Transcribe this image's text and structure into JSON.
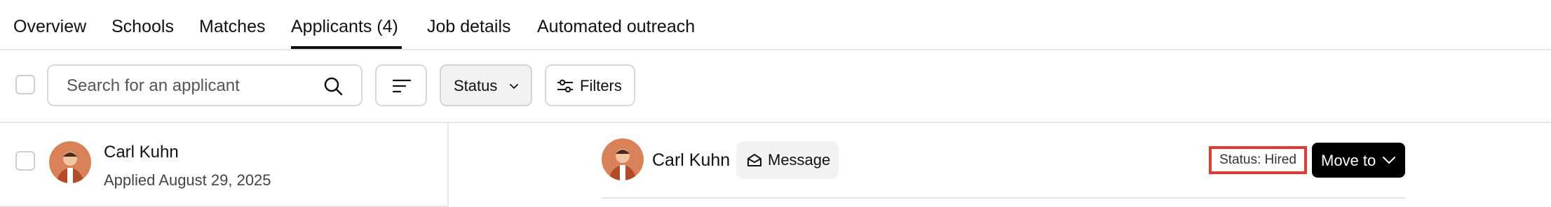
{
  "tabs": [
    {
      "label": "Overview"
    },
    {
      "label": "Schools"
    },
    {
      "label": "Matches"
    },
    {
      "label": "Applicants (4)",
      "active": true
    },
    {
      "label": "Job details"
    },
    {
      "label": "Automated outreach"
    }
  ],
  "toolbar": {
    "search_placeholder": "Search for an applicant",
    "sort_icon": "sort-lines-icon",
    "status_label": "Status",
    "filters_label": "Filters"
  },
  "applicant_list": [
    {
      "name": "Carl Kuhn",
      "applied": "Applied August 29, 2025"
    }
  ],
  "detail": {
    "name": "Carl Kuhn",
    "message_label": "Message",
    "status_text": "Status: Hired",
    "move_label": "Move to"
  },
  "colors": {
    "accent_black": "#000000",
    "highlight_red": "#e13b2f",
    "avatar_bg": "#d9825a"
  }
}
